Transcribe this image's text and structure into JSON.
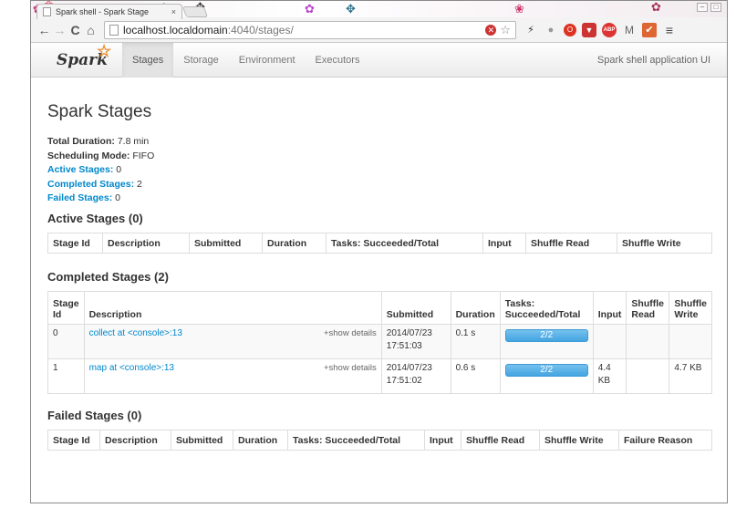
{
  "browser": {
    "tab_title": "Spark shell - Spark Stage",
    "tab_close": "×",
    "url_host": "localhost.localdomain",
    "url_path": ":4040/stages/",
    "icons": [
      "back-arrow-icon",
      "forward-arrow-icon",
      "reload-icon",
      "home-icon",
      "page-icon",
      "stop-icon",
      "bookmark-star-icon"
    ]
  },
  "sparknav": {
    "logo": "Spark",
    "tabs": [
      {
        "label": "Stages",
        "active": true
      },
      {
        "label": "Storage",
        "active": false
      },
      {
        "label": "Environment",
        "active": false
      },
      {
        "label": "Executors",
        "active": false
      }
    ],
    "app_name": "Spark shell application UI"
  },
  "page": {
    "title": "Spark Stages",
    "summary": {
      "total_duration_label": "Total Duration:",
      "total_duration_value": "7.8 min",
      "scheduling_mode_label": "Scheduling Mode:",
      "scheduling_mode_value": "FIFO",
      "active_label": "Active Stages:",
      "active_value": "0",
      "completed_label": "Completed Stages:",
      "completed_value": "2",
      "failed_label": "Failed Stages:",
      "failed_value": "0"
    }
  },
  "active_stages": {
    "heading": "Active Stages (0)",
    "columns": [
      "Stage Id",
      "Description",
      "Submitted",
      "Duration",
      "Tasks: Succeeded/Total",
      "Input",
      "Shuffle Read",
      "Shuffle Write"
    ]
  },
  "completed_stages": {
    "heading": "Completed Stages (2)",
    "columns": [
      "Stage\nId",
      "Description",
      "Submitted",
      "Duration",
      "Tasks:\nSucceeded/Total",
      "Input",
      "Shuffle\nRead",
      "Shuffle\nWrite"
    ],
    "show_details": "+show details",
    "rows": [
      {
        "id": "0",
        "desc": "collect at <console>:13",
        "submitted": "2014/07/23\n17:51:03",
        "duration": "0.1 s",
        "tasks": "2/2",
        "progress": 1.0,
        "input": "",
        "shuffle_read": "",
        "shuffle_write": ""
      },
      {
        "id": "1",
        "desc": "map at <console>:13",
        "submitted": "2014/07/23\n17:51:02",
        "duration": "0.6 s",
        "tasks": "2/2",
        "progress": 1.0,
        "input": "4.4\nKB",
        "shuffle_read": "",
        "shuffle_write": "4.7 KB"
      }
    ]
  },
  "failed_stages": {
    "heading": "Failed Stages (0)",
    "columns": [
      "Stage Id",
      "Description",
      "Submitted",
      "Duration",
      "Tasks: Succeeded/Total",
      "Input",
      "Shuffle Read",
      "Shuffle Write",
      "Failure Reason"
    ]
  },
  "colors": {
    "link": "#0088cc",
    "progress": "#44a4e0",
    "logo_star": "#e88b2d"
  }
}
